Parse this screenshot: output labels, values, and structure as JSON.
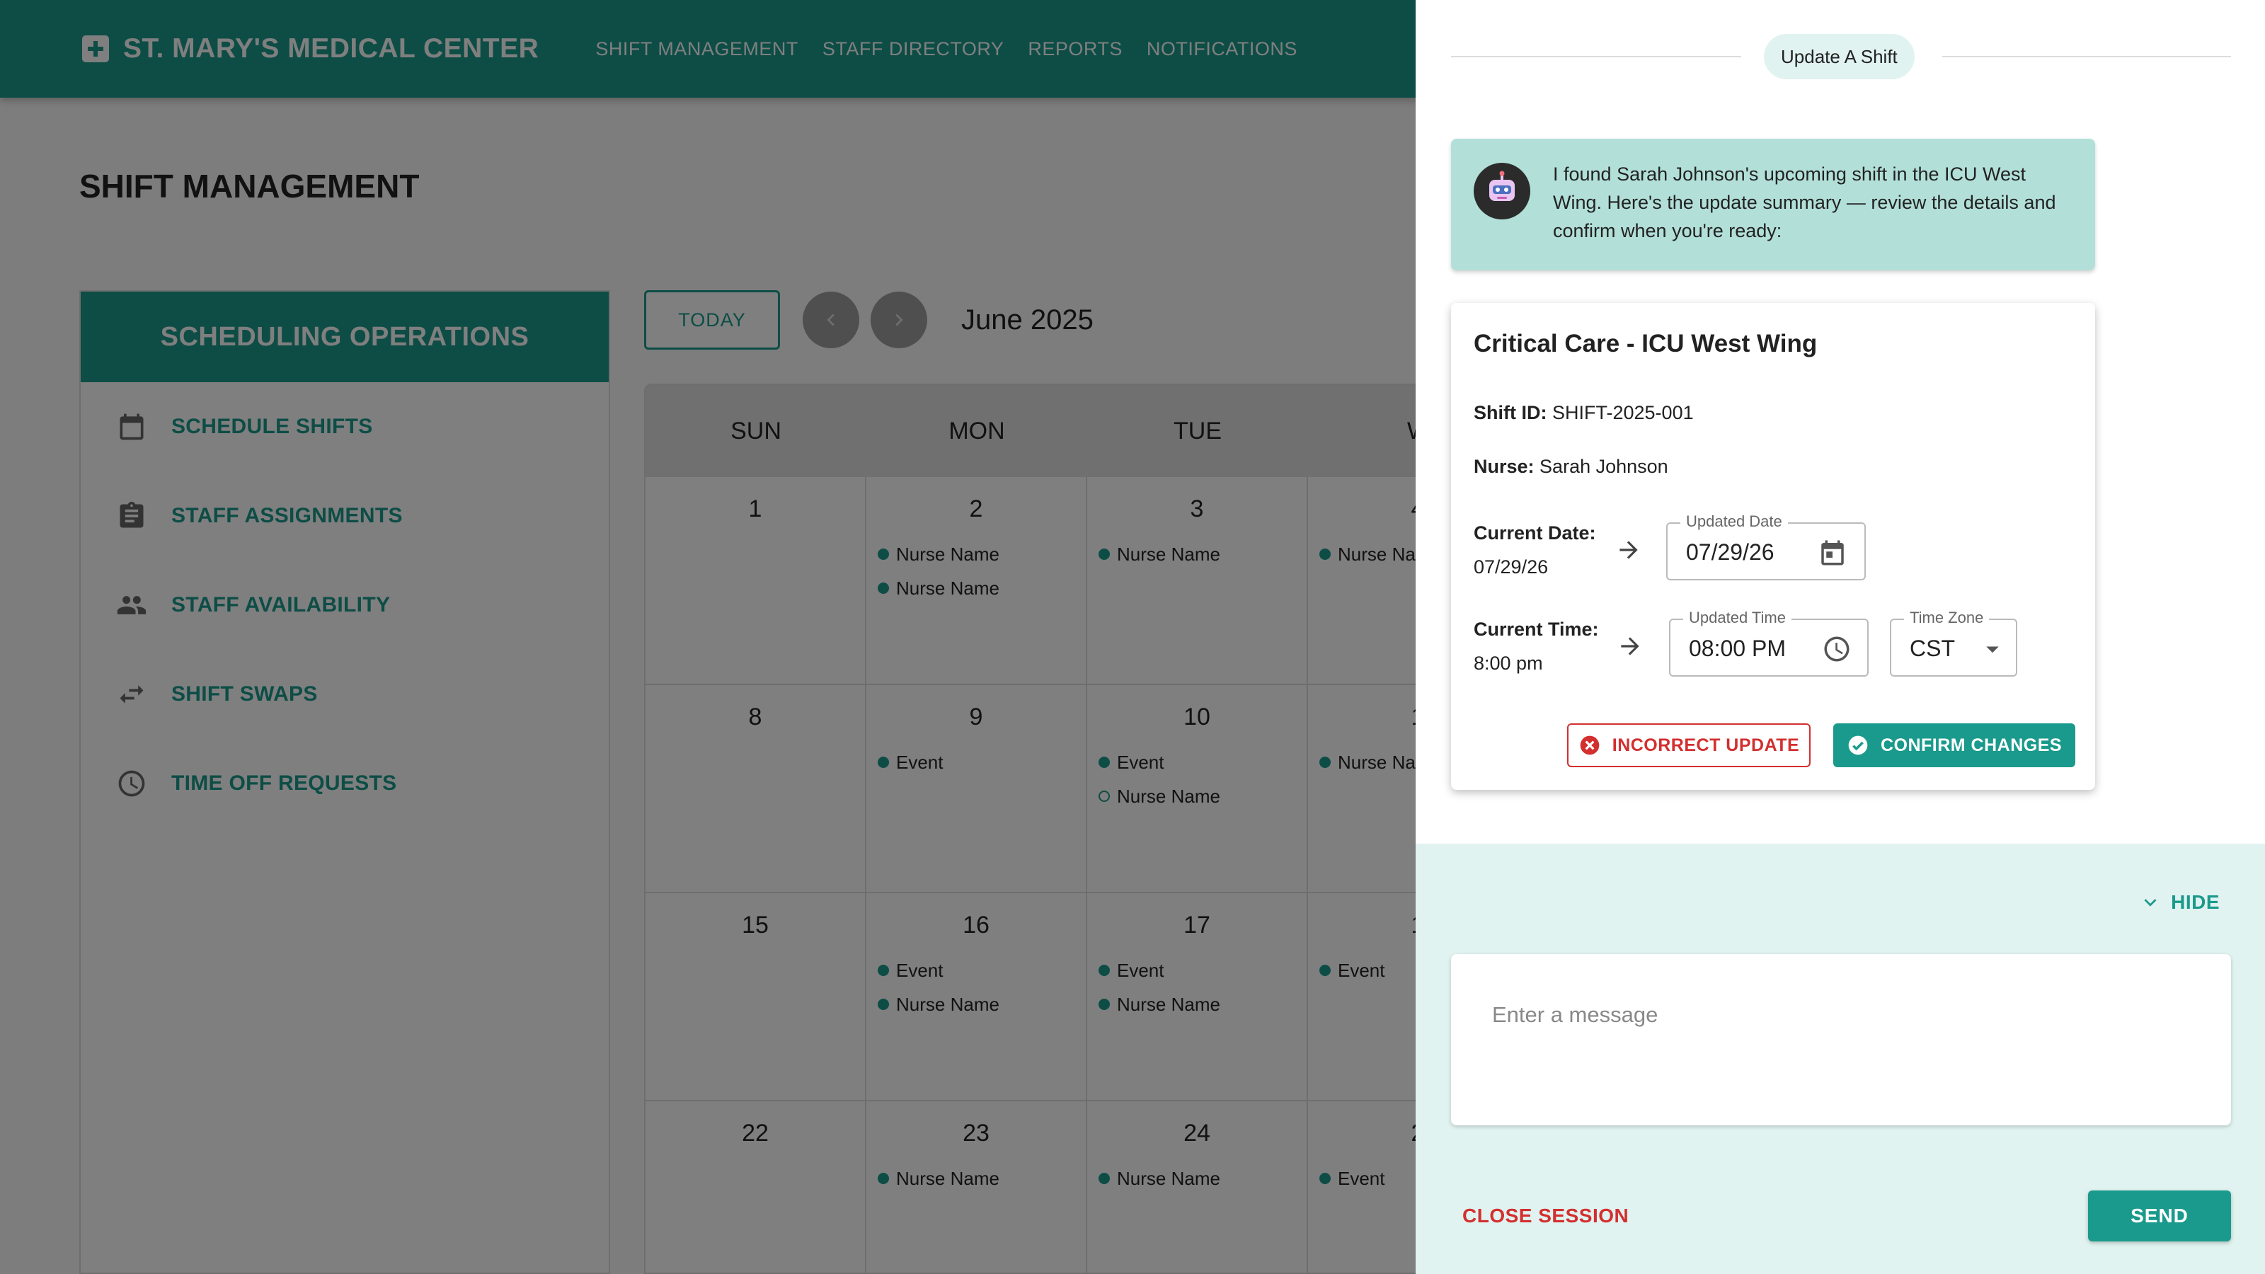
{
  "topbar": {
    "brand": "ST. MARY'S MEDICAL CENTER",
    "brand_icon": "hospital-cross-icon",
    "nav": [
      "SHIFT MANAGEMENT",
      "STAFF DIRECTORY",
      "REPORTS",
      "NOTIFICATIONS"
    ],
    "color": "#1a9a8c"
  },
  "page": {
    "title": "SHIFT MANAGEMENT"
  },
  "sidebar": {
    "header": "SCHEDULING OPERATIONS",
    "items": [
      {
        "label": "SCHEDULE SHIFTS",
        "icon": "calendar-icon"
      },
      {
        "label": "STAFF ASSIGNMENTS",
        "icon": "clipboard-icon"
      },
      {
        "label": "STAFF AVAILABILITY",
        "icon": "people-icon"
      },
      {
        "label": "SHIFT SWAPS",
        "icon": "swap-icon"
      },
      {
        "label": "TIME OFF REQUESTS",
        "icon": "clock-icon"
      }
    ]
  },
  "calendar": {
    "today_label": "TODAY",
    "month": "June 2025",
    "weekdays": [
      "SUN",
      "MON",
      "TUE",
      "W"
    ],
    "weeks": [
      [
        {
          "day": "1",
          "events": []
        },
        {
          "day": "2",
          "events": [
            {
              "label": "Nurse Name",
              "hollow": false
            },
            {
              "label": "Nurse Name",
              "hollow": false
            }
          ]
        },
        {
          "day": "3",
          "events": [
            {
              "label": "Nurse Name",
              "hollow": false
            }
          ]
        },
        {
          "day": "4",
          "events": [
            {
              "label": "Nurse Na",
              "hollow": false
            }
          ]
        }
      ],
      [
        {
          "day": "8",
          "events": []
        },
        {
          "day": "9",
          "events": [
            {
              "label": "Event",
              "hollow": false
            }
          ]
        },
        {
          "day": "10",
          "events": [
            {
              "label": "Event",
              "hollow": false
            },
            {
              "label": "Nurse Name",
              "hollow": true
            }
          ]
        },
        {
          "day": "1",
          "events": [
            {
              "label": "Nurse Na",
              "hollow": false
            }
          ]
        }
      ],
      [
        {
          "day": "15",
          "events": []
        },
        {
          "day": "16",
          "events": [
            {
              "label": "Event",
              "hollow": false
            },
            {
              "label": "Nurse Name",
              "hollow": false
            }
          ]
        },
        {
          "day": "17",
          "events": [
            {
              "label": "Event",
              "hollow": false
            },
            {
              "label": "Nurse Name",
              "hollow": false
            }
          ]
        },
        {
          "day": "1",
          "events": [
            {
              "label": "Event",
              "hollow": false
            }
          ]
        }
      ],
      [
        {
          "day": "22",
          "events": []
        },
        {
          "day": "23",
          "events": [
            {
              "label": "Nurse Name",
              "hollow": false
            }
          ]
        },
        {
          "day": "24",
          "events": [
            {
              "label": "Nurse Name",
              "hollow": false
            }
          ]
        },
        {
          "day": "2",
          "events": [
            {
              "label": "Event",
              "hollow": false
            }
          ]
        }
      ]
    ]
  },
  "panel": {
    "pill": "Update A Shift",
    "bot_message": "I found Sarah Johnson's upcoming shift in the ICU West Wing. Here's the update summary — review the details and confirm when you're ready:",
    "card": {
      "title": "Critical Care - ICU West Wing",
      "shift_id_label": "Shift ID:",
      "shift_id": "SHIFT-2025-001",
      "nurse_label": "Nurse:",
      "nurse": "Sarah Johnson",
      "current_date_label": "Current Date:",
      "current_date": "07/29/26",
      "updated_date_label": "Updated Date",
      "updated_date": "07/29/26",
      "current_time_label": "Current Time:",
      "current_time": "8:00 pm",
      "updated_time_label": "Updated Time",
      "updated_time": "08:00 PM",
      "timezone_label": "Time Zone",
      "timezone": "CST",
      "incorrect_label": "INCORRECT UPDATE",
      "confirm_label": "CONFIRM CHANGES"
    },
    "hide_label": "HIDE",
    "message_placeholder": "Enter a message",
    "close_session_label": "CLOSE SESSION",
    "send_label": "SEND",
    "accent": "#1a9a8c",
    "danger": "#d32f2f"
  }
}
